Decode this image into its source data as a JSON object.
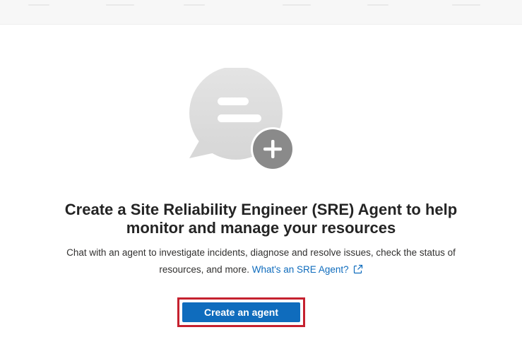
{
  "empty_state": {
    "illustration_icon": "chat-bubble-plus-icon",
    "title_line1": "Create a Site Reliability Engineer (SRE) Agent to help",
    "title_line2": "monitor and manage your resources",
    "description_line1": "Chat with an agent to investigate incidents, diagnose and resolve issues, check the status of",
    "description_line2_prefix": "resources, and more. ",
    "learn_more_link": "What's an SRE Agent?",
    "link_icon": "external-link-icon",
    "create_button_label": "Create an agent"
  },
  "colors": {
    "accent": "#0f6cbd",
    "highlight_border": "#c5212f",
    "bubble": "#e1e1e1",
    "plus_badge": "#8a8a8a"
  }
}
